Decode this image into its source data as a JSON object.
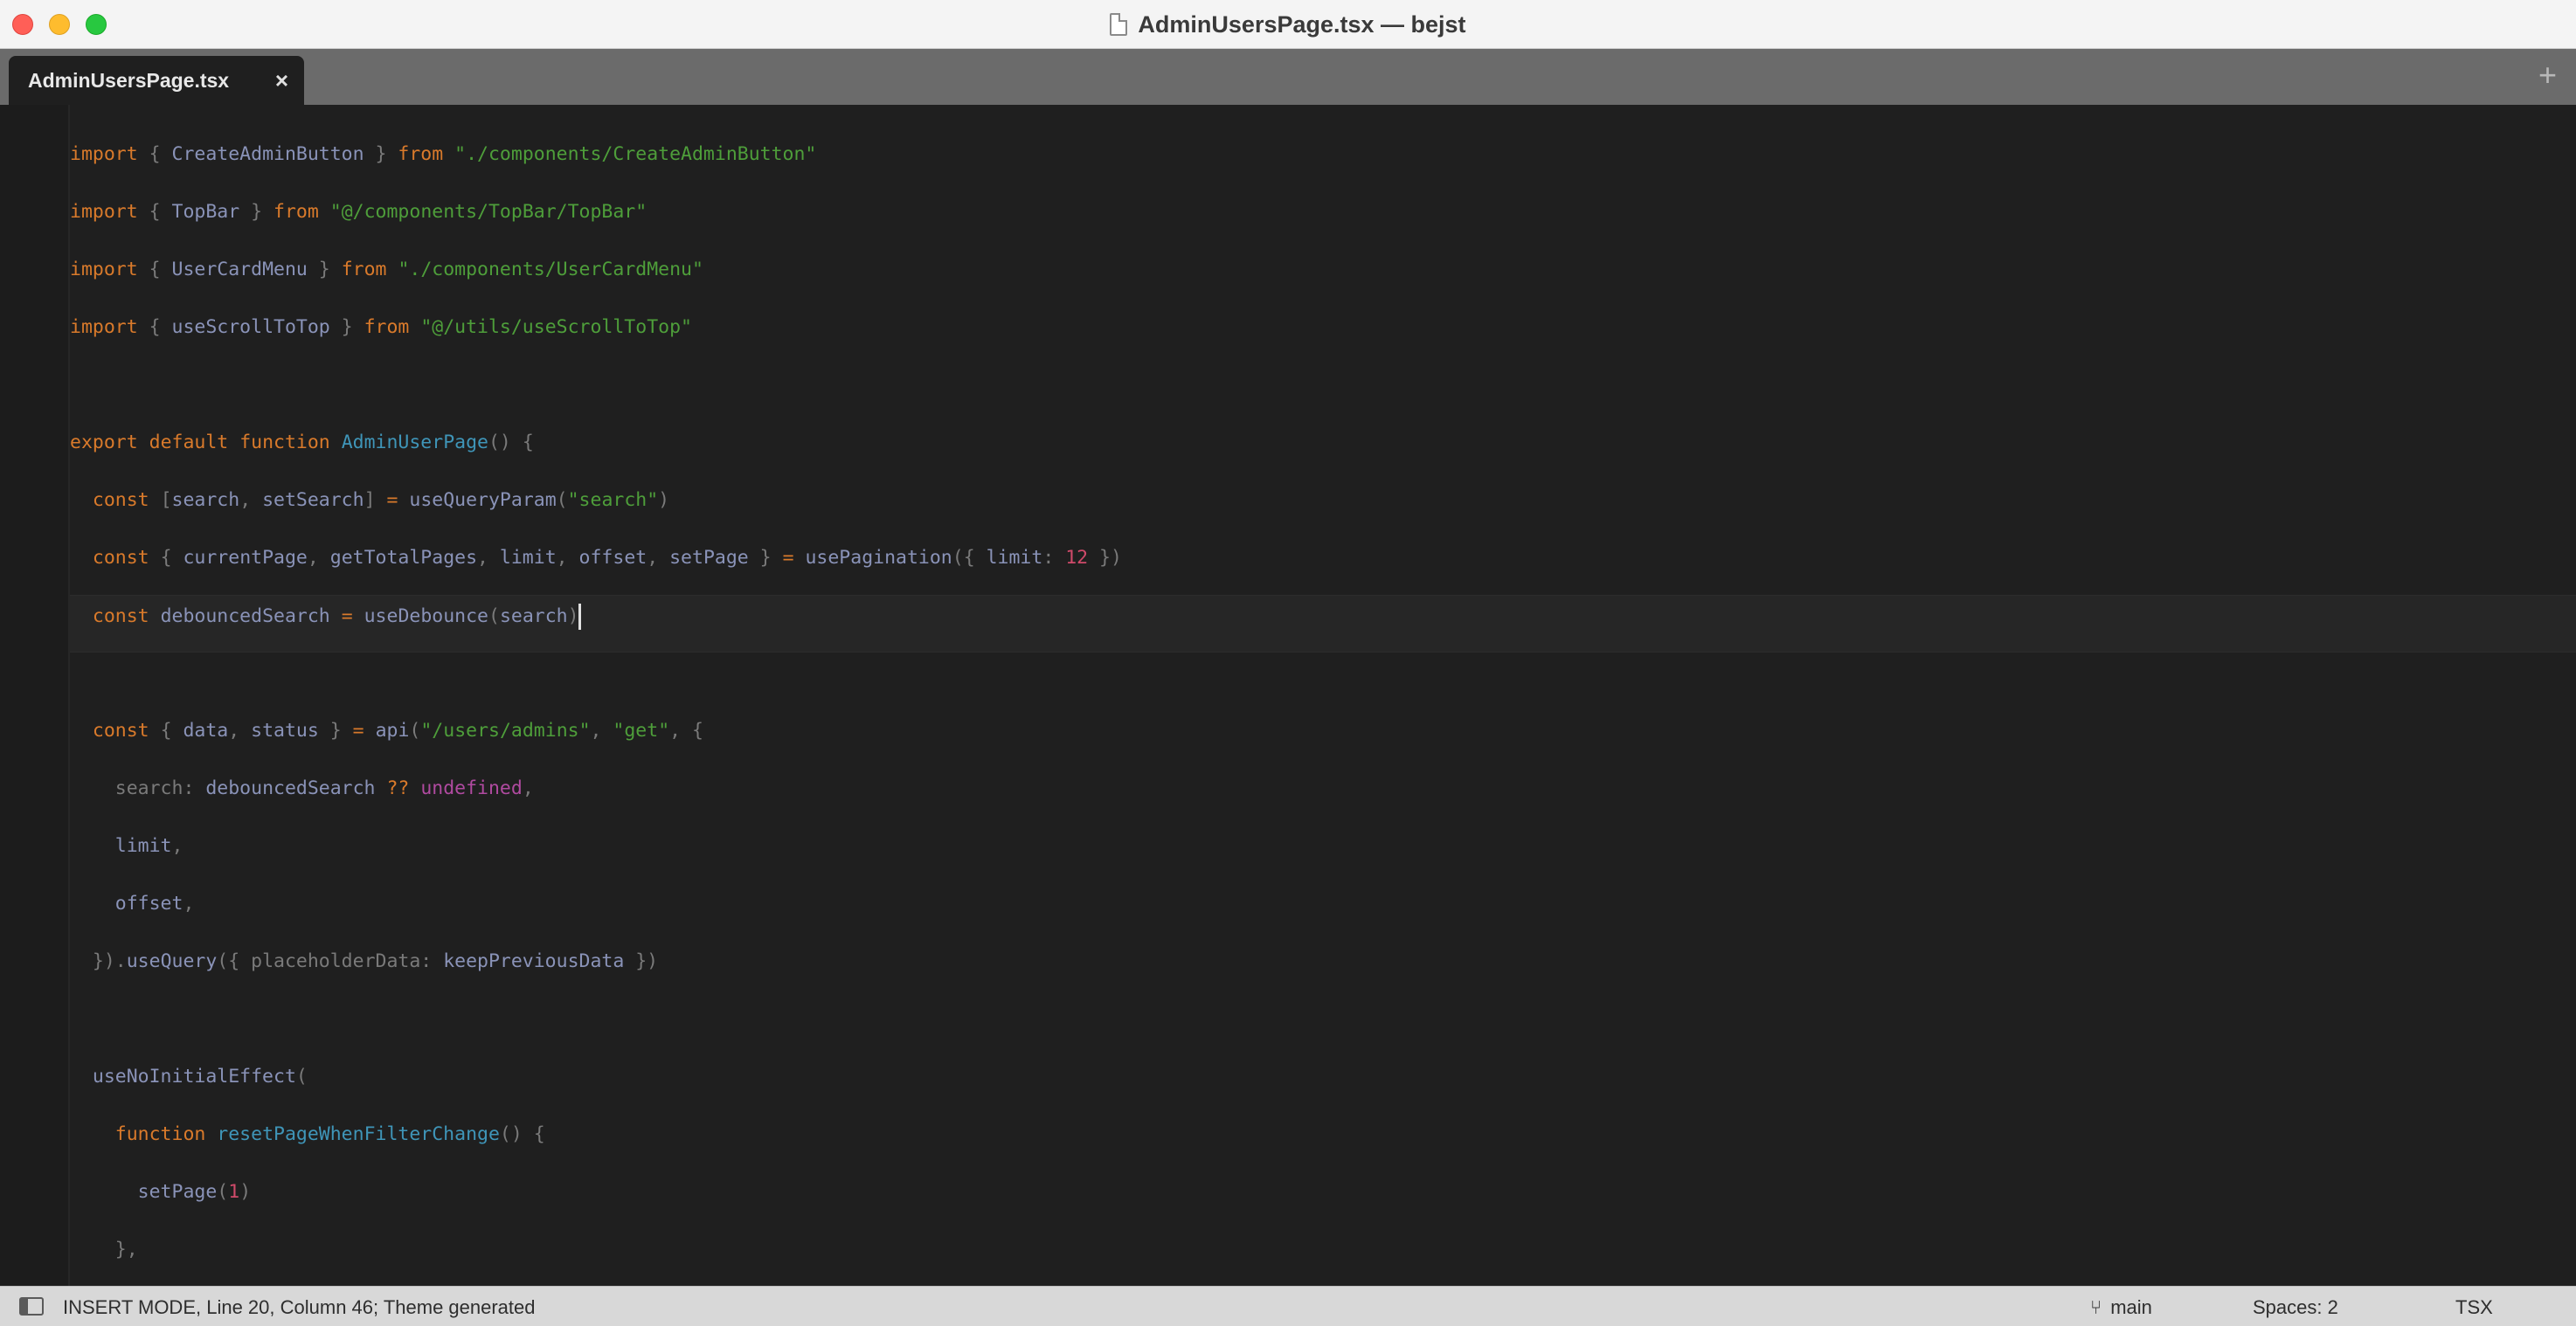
{
  "window": {
    "title": "AdminUsersPage.tsx — bejst"
  },
  "tabs": [
    {
      "label": "AdminUsersPage.tsx",
      "close_glyph": "×"
    }
  ],
  "tabbar": {
    "add_glyph": "+"
  },
  "editor": {
    "lines": [
      [
        [
          "kw",
          "import"
        ],
        [
          "pn",
          " { "
        ],
        [
          "id",
          "CreateAdminButton"
        ],
        [
          "pn",
          " } "
        ],
        [
          "kw",
          "from"
        ],
        [
          "pn",
          " "
        ],
        [
          "str",
          "\"./components/CreateAdminButton\""
        ]
      ],
      [
        [
          "kw",
          "import"
        ],
        [
          "pn",
          " { "
        ],
        [
          "id",
          "TopBar"
        ],
        [
          "pn",
          " } "
        ],
        [
          "kw",
          "from"
        ],
        [
          "pn",
          " "
        ],
        [
          "str",
          "\"@/components/TopBar/TopBar\""
        ]
      ],
      [
        [
          "kw",
          "import"
        ],
        [
          "pn",
          " { "
        ],
        [
          "id",
          "UserCardMenu"
        ],
        [
          "pn",
          " } "
        ],
        [
          "kw",
          "from"
        ],
        [
          "pn",
          " "
        ],
        [
          "str",
          "\"./components/UserCardMenu\""
        ]
      ],
      [
        [
          "kw",
          "import"
        ],
        [
          "pn",
          " { "
        ],
        [
          "id",
          "useScrollToTop"
        ],
        [
          "pn",
          " } "
        ],
        [
          "kw",
          "from"
        ],
        [
          "pn",
          " "
        ],
        [
          "str",
          "\"@/utils/useScrollToTop\""
        ]
      ],
      [],
      [
        [
          "kw",
          "export"
        ],
        [
          "pn",
          " "
        ],
        [
          "kw",
          "default"
        ],
        [
          "pn",
          " "
        ],
        [
          "kw",
          "function"
        ],
        [
          "pn",
          " "
        ],
        [
          "fn",
          "AdminUserPage"
        ],
        [
          "pn",
          "() {"
        ]
      ],
      [
        [
          "pn",
          "  "
        ],
        [
          "kw",
          "const"
        ],
        [
          "pn",
          " ["
        ],
        [
          "id",
          "search"
        ],
        [
          "pn",
          ", "
        ],
        [
          "id",
          "setSearch"
        ],
        [
          "pn",
          "] "
        ],
        [
          "op",
          "="
        ],
        [
          "pn",
          " "
        ],
        [
          "id",
          "useQueryParam"
        ],
        [
          "pn",
          "("
        ],
        [
          "str",
          "\"search\""
        ],
        [
          "pn",
          ")"
        ]
      ],
      [
        [
          "pn",
          "  "
        ],
        [
          "kw",
          "const"
        ],
        [
          "pn",
          " { "
        ],
        [
          "id",
          "currentPage"
        ],
        [
          "pn",
          ", "
        ],
        [
          "id",
          "getTotalPages"
        ],
        [
          "pn",
          ", "
        ],
        [
          "id",
          "limit"
        ],
        [
          "pn",
          ", "
        ],
        [
          "id",
          "offset"
        ],
        [
          "pn",
          ", "
        ],
        [
          "id",
          "setPage"
        ],
        [
          "pn",
          " } "
        ],
        [
          "op",
          "="
        ],
        [
          "pn",
          " "
        ],
        [
          "id",
          "usePagination"
        ],
        [
          "pn",
          "({ "
        ],
        [
          "id",
          "limit"
        ],
        [
          "pn",
          ": "
        ],
        [
          "num",
          "12"
        ],
        [
          "pn",
          " })"
        ]
      ],
      [
        [
          "pn",
          "  "
        ],
        [
          "kw",
          "const"
        ],
        [
          "pn",
          " "
        ],
        [
          "id",
          "debouncedSearch"
        ],
        [
          "pn",
          " "
        ],
        [
          "op",
          "="
        ],
        [
          "pn",
          " "
        ],
        [
          "id",
          "useDebounce"
        ],
        [
          "pn",
          "("
        ],
        [
          "id",
          "search"
        ],
        [
          "pn",
          ")"
        ]
      ],
      [],
      [
        [
          "pn",
          "  "
        ],
        [
          "kw",
          "const"
        ],
        [
          "pn",
          " { "
        ],
        [
          "id",
          "data"
        ],
        [
          "pn",
          ", "
        ],
        [
          "id",
          "status"
        ],
        [
          "pn",
          " } "
        ],
        [
          "op",
          "="
        ],
        [
          "pn",
          " "
        ],
        [
          "id",
          "api"
        ],
        [
          "pn",
          "("
        ],
        [
          "str",
          "\"/users/admins\""
        ],
        [
          "pn",
          ", "
        ],
        [
          "str",
          "\"get\""
        ],
        [
          "pn",
          ", {"
        ]
      ],
      [
        [
          "pn",
          "    "
        ],
        [
          "pn",
          "search: "
        ],
        [
          "id",
          "debouncedSearch"
        ],
        [
          "pn",
          " "
        ],
        [
          "op",
          "??"
        ],
        [
          "pn",
          " "
        ],
        [
          "undef",
          "undefined"
        ],
        [
          "pn",
          ","
        ]
      ],
      [
        [
          "pn",
          "    "
        ],
        [
          "id",
          "limit"
        ],
        [
          "pn",
          ","
        ]
      ],
      [
        [
          "pn",
          "    "
        ],
        [
          "id",
          "offset"
        ],
        [
          "pn",
          ","
        ]
      ],
      [
        [
          "pn",
          "  })."
        ],
        [
          "id",
          "useQuery"
        ],
        [
          "pn",
          "({ placeholderData: "
        ],
        [
          "id",
          "keepPreviousData"
        ],
        [
          "pn",
          " })"
        ]
      ],
      [],
      [
        [
          "pn",
          "  "
        ],
        [
          "id",
          "useNoInitialEffect"
        ],
        [
          "pn",
          "("
        ]
      ],
      [
        [
          "pn",
          "    "
        ],
        [
          "kw",
          "function"
        ],
        [
          "pn",
          " "
        ],
        [
          "fn",
          "resetPageWhenFilterChange"
        ],
        [
          "pn",
          "() {"
        ]
      ],
      [
        [
          "pn",
          "      "
        ],
        [
          "id",
          "setPage"
        ],
        [
          "pn",
          "("
        ],
        [
          "num",
          "1"
        ],
        [
          "pn",
          ")"
        ]
      ],
      [
        [
          "pn",
          "    },"
        ]
      ]
    ],
    "current_line_index": 8
  },
  "statusbar": {
    "mode_text": "INSERT MODE, Line 20, Column 46; Theme generated",
    "branch": "main",
    "branch_icon": "git-branch-icon",
    "indentation": "Spaces: 2",
    "syntax": "TSX"
  },
  "colors": {
    "keyword": "#d97a2b",
    "string": "#4e9e3a",
    "function": "#3f95b8",
    "identifier": "#8a93b8",
    "number": "#d04a6a",
    "undefined": "#b04aa0",
    "background": "#1f1f1f"
  }
}
